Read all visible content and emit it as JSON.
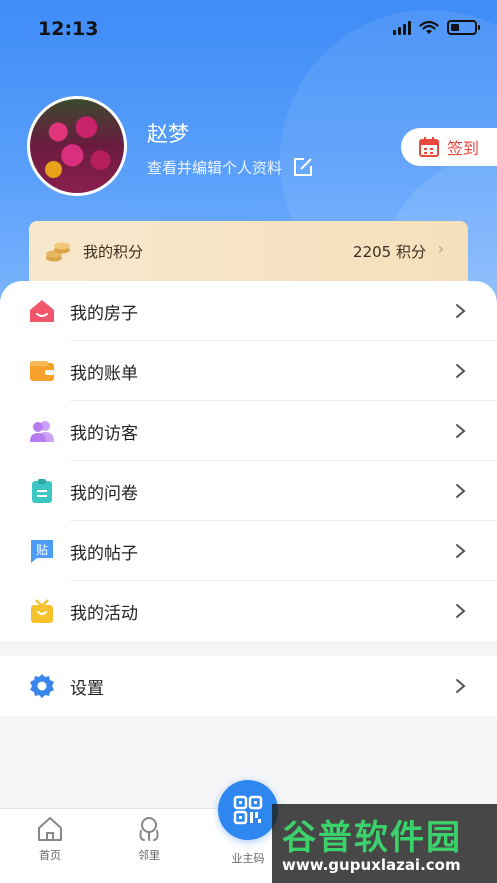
{
  "status_bar": {
    "time": "12:13"
  },
  "profile": {
    "name": "赵梦",
    "edit_text": "查看并编辑个人资料",
    "checkin_label": "签到"
  },
  "points": {
    "label": "我的积分",
    "value": "2205 积分"
  },
  "menu": {
    "items": [
      {
        "label": "我的房子",
        "icon": "house-icon",
        "color": "#f0556a"
      },
      {
        "label": "我的账单",
        "icon": "wallet-icon",
        "color": "#f5a12b"
      },
      {
        "label": "我的访客",
        "icon": "visitors-icon",
        "color": "#b77cf0"
      },
      {
        "label": "我的问卷",
        "icon": "clipboard-icon",
        "color": "#3cc7c5"
      },
      {
        "label": "我的帖子",
        "icon": "post-icon",
        "color": "#4d9cf5"
      },
      {
        "label": "我的活动",
        "icon": "gift-icon",
        "color": "#f5c22b"
      }
    ]
  },
  "settings": {
    "label": "设置",
    "icon": "gear-icon",
    "color": "#3b86ec"
  },
  "tabbar": {
    "home": "首页",
    "neighbor": "邻里",
    "owner_code": "业主码"
  },
  "watermark": {
    "title": "谷普软件园",
    "url": "www.gupuxlazai.com"
  }
}
